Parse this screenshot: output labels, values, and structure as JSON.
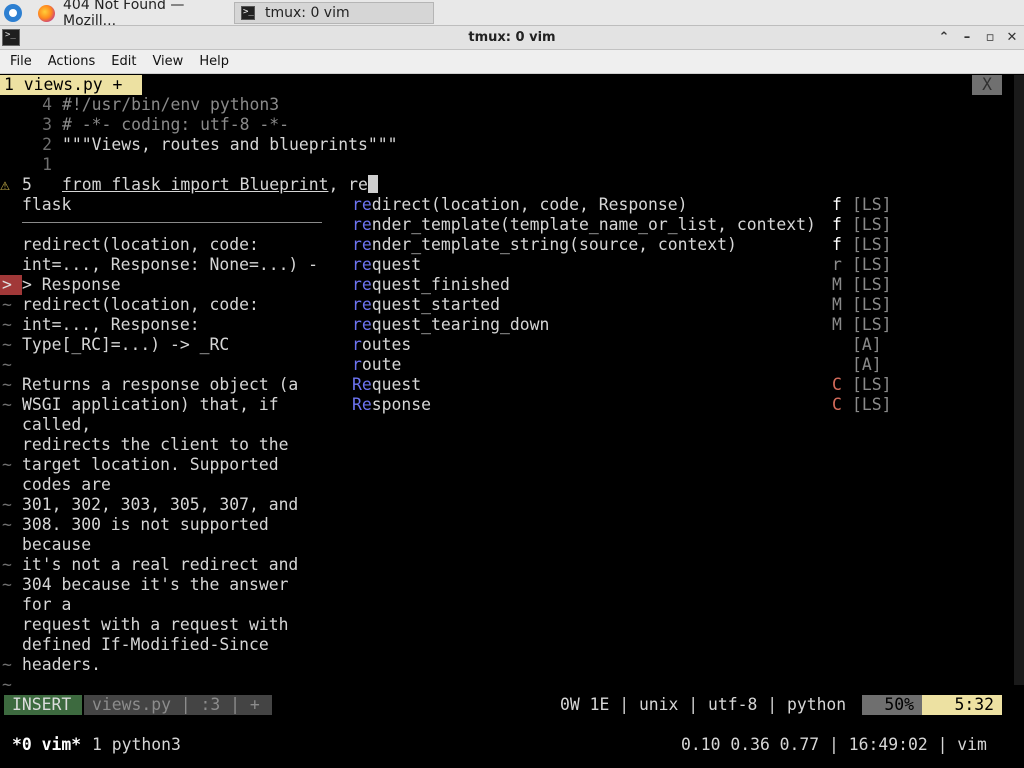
{
  "taskbar": {
    "tasks": [
      {
        "label": "404 Not Found — Mozill..."
      },
      {
        "label": "tmux: 0 vim"
      }
    ]
  },
  "window": {
    "title": "tmux: 0 vim",
    "buttons": {
      "minimize": "^",
      "shade": "—",
      "maximize": "□",
      "close": "✕"
    }
  },
  "menu": [
    "File",
    "Actions",
    "Edit",
    "View",
    "Help"
  ],
  "vim": {
    "tab_label": "1 views.py +",
    "tab_close": "X",
    "lines": [
      {
        "num": "4",
        "text": "#!/usr/bin/env python3"
      },
      {
        "num": "3",
        "text": "# -*- coding: utf-8 -*-"
      },
      {
        "num": "2",
        "text": "\"\"\"Views, routes and blueprints\"\"\""
      },
      {
        "num": "1",
        "text": ""
      }
    ],
    "current_line": {
      "sign": "⚠",
      "num": "5",
      "text_underlined": "from flask import Blueprint",
      "text_rest": ", re"
    },
    "doc_title": "flask",
    "doc_lines": [
      {
        "marker": " ",
        "text": "redirect(location, code:"
      },
      {
        "marker": " ",
        "text": "int=..., Response: None=...) -"
      },
      {
        "marker": ">",
        "text": "> Response"
      },
      {
        "marker": "~",
        "text": "redirect(location, code:"
      },
      {
        "marker": "~",
        "text": "int=..., Response:"
      },
      {
        "marker": "~",
        "text": "Type[_RC]=...) -> _RC"
      },
      {
        "marker": "~",
        "text": ""
      },
      {
        "marker": "~",
        "text": "Returns a response object (a"
      },
      {
        "marker": "~",
        "text": "WSGI application) that, if"
      },
      {
        "marker": " ",
        "text": "called,"
      },
      {
        "marker": " ",
        "text": "redirects the client to the"
      },
      {
        "marker": "~",
        "text": "target location. Supported"
      },
      {
        "marker": " ",
        "text": "codes are"
      },
      {
        "marker": "~",
        "text": "301, 302, 303, 305, 307, and"
      },
      {
        "marker": "~",
        "text": "308. 300 is not supported"
      },
      {
        "marker": " ",
        "text": "because"
      },
      {
        "marker": "~",
        "text": "it's not a real redirect and"
      },
      {
        "marker": "~",
        "text": "304 because it's the answer"
      },
      {
        "marker": " ",
        "text": "for a"
      },
      {
        "marker": " ",
        "text": "request with a request with"
      },
      {
        "marker": " ",
        "text": "defined If-Modified-Since"
      },
      {
        "marker": "~",
        "text": "headers."
      },
      {
        "marker": "~",
        "text": ""
      }
    ],
    "completions": [
      {
        "match": "re",
        "rest": "direct(location, code, Response)",
        "kind": "f",
        "src": "[LS]"
      },
      {
        "match": "re",
        "rest": "nder_template(template_name_or_list, context)",
        "kind": "f",
        "src": "[LS]"
      },
      {
        "match": "re",
        "rest": "nder_template_string(source, context)",
        "kind": "f",
        "src": "[LS]"
      },
      {
        "match": "re",
        "rest": "quest",
        "kind": "r",
        "src": "[LS]"
      },
      {
        "match": "re",
        "rest": "quest_finished",
        "kind": "M",
        "src": "[LS]"
      },
      {
        "match": "re",
        "rest": "quest_started",
        "kind": "M",
        "src": "[LS]"
      },
      {
        "match": "re",
        "rest": "quest_tearing_down",
        "kind": "M",
        "src": "[LS]"
      },
      {
        "match": "r",
        "rest": "outes",
        "kind": "",
        "src": "[A]"
      },
      {
        "match": "r",
        "rest": "oute",
        "kind": "",
        "src": "[A]"
      },
      {
        "match": "Re",
        "rest": "quest",
        "kind": "C",
        "src": "[LS]"
      },
      {
        "match": "Re",
        "rest": "sponse",
        "kind": "C",
        "src": "[LS]"
      }
    ],
    "status": {
      "mode": "INSERT",
      "file": "views.py | :3 | +",
      "diagnostics": "0W 1E",
      "format": "unix",
      "encoding": "utf-8",
      "filetype": "python",
      "right_info": "0W 1E | unix | utf-8 | python",
      "percent": "50%",
      "position": "5:32"
    }
  },
  "tmux": {
    "active_window": "*0 vim*",
    "other_window": "1 python3",
    "right": "0.10 0.36 0.77 | 16:49:02 | vim"
  }
}
